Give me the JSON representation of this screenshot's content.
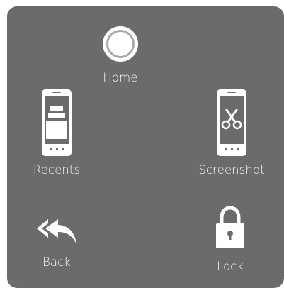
{
  "menu": {
    "home": {
      "label": "Home",
      "icon": "home-button-icon"
    },
    "recents": {
      "label": "Recents",
      "icon": "recents-phone-icon"
    },
    "screenshot": {
      "label": "Screenshot",
      "icon": "screenshot-scissors-icon"
    },
    "back": {
      "label": "Back",
      "icon": "back-double-arrow-icon"
    },
    "lock": {
      "label": "Lock",
      "icon": "padlock-icon"
    }
  },
  "colors": {
    "panel_background": "#6b6b6b",
    "icon_foreground": "#ffffff",
    "home_ring": "#a8a8a8"
  }
}
